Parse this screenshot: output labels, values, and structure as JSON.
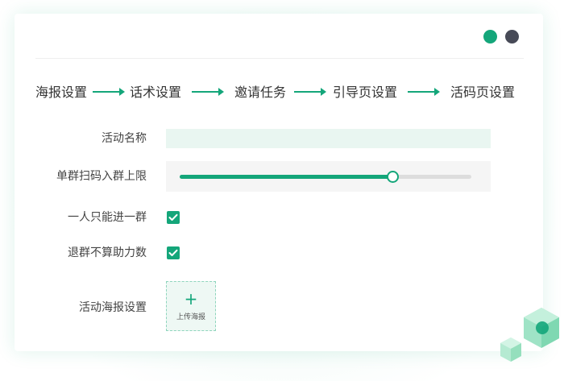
{
  "window": {
    "controls": [
      {
        "name": "green-dot",
        "color": "#14a67a"
      },
      {
        "name": "dark-dot",
        "color": "#474a57"
      }
    ]
  },
  "steps": [
    {
      "label": "海报设置"
    },
    {
      "label": "话术设置"
    },
    {
      "label": "邀请任务"
    },
    {
      "label": "引导页设置"
    },
    {
      "label": "活码页设置"
    }
  ],
  "form": {
    "activity_name": {
      "label": "活动名称",
      "value": ""
    },
    "group_limit": {
      "label": "单群扫码入群上限",
      "level": 0.73
    },
    "one_group_only": {
      "label": "一人只能进一群",
      "checked": true
    },
    "leave_not_counted": {
      "label": "退群不算助力数",
      "checked": true
    },
    "poster": {
      "label": "活动海报设置",
      "upload_text": "上传海报",
      "upload_icon": "plus-icon"
    }
  },
  "colors": {
    "accent": "#14a67a",
    "input_bg": "#e9f6f1",
    "track": "#dddddd"
  }
}
